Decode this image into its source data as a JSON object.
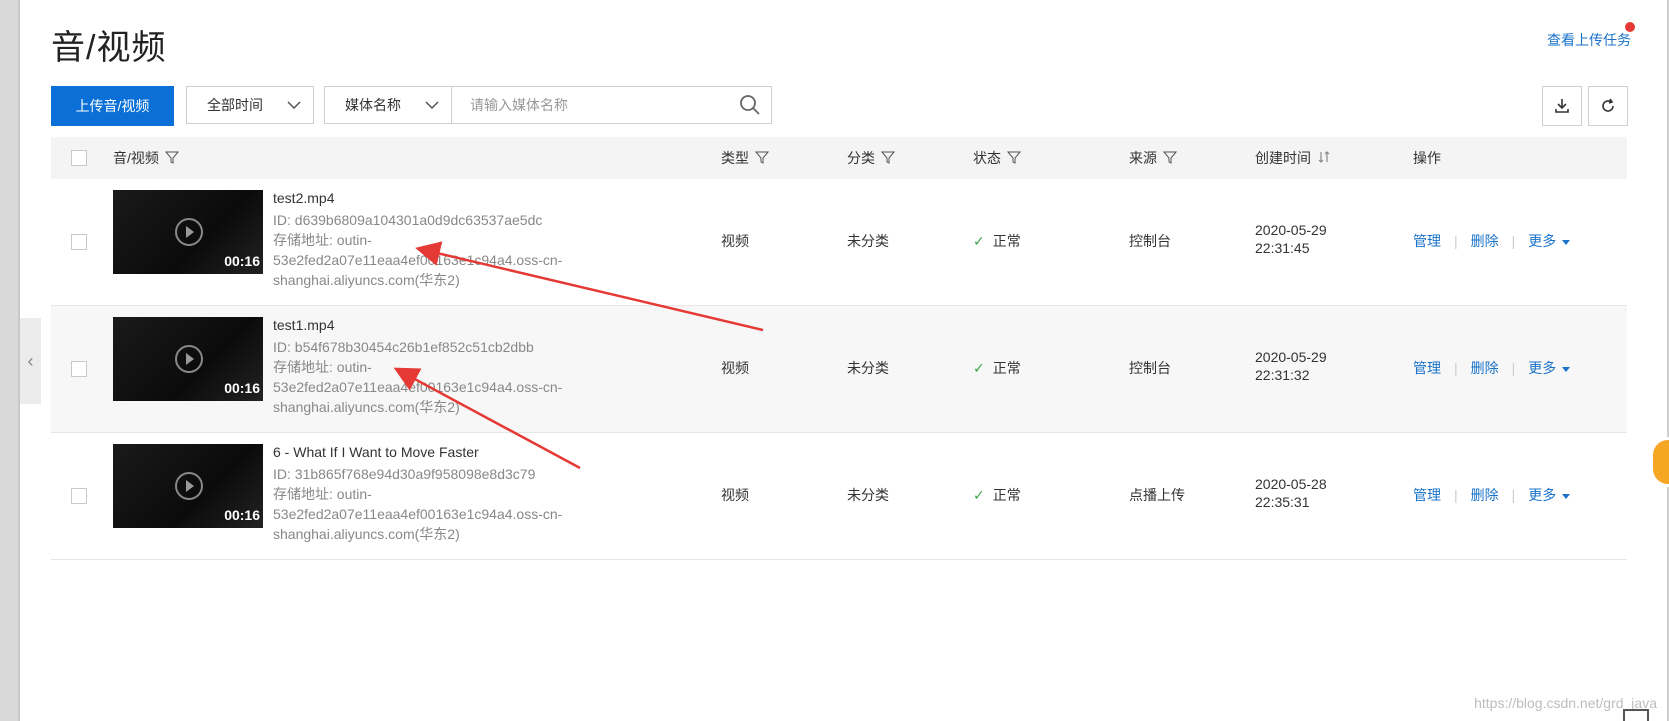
{
  "header": {
    "title": "音/视频",
    "upload_tasks_link": "查看上传任务"
  },
  "toolbar": {
    "upload_button": "上传音/视频",
    "time_filter": "全部时间",
    "search_field_select": "媒体名称",
    "search_placeholder": "请输入媒体名称"
  },
  "table": {
    "columns": {
      "media": "音/视频",
      "type": "类型",
      "category": "分类",
      "status": "状态",
      "source": "来源",
      "created": "创建时间",
      "actions": "操作"
    },
    "rows": [
      {
        "name": "test2.mp4",
        "id": "ID:  d639b6809a104301a0d9dc63537ae5dc",
        "storage_line1": "存储地址:  outin-",
        "storage_line2": "53e2fed2a07e11eaa4ef00163e1c94a4.oss-cn-",
        "storage_line3": "shanghai.aliyuncs.com(华东2)",
        "duration": "00:16",
        "type": "视频",
        "category": "未分类",
        "status": "正常",
        "source": "控制台",
        "created_date": "2020-05-29",
        "created_time": "22:31:45",
        "actions": {
          "manage": "管理",
          "delete": "删除",
          "more": "更多"
        }
      },
      {
        "name": "test1.mp4",
        "id": "ID:  b54f678b30454c26b1ef852c51cb2dbb",
        "storage_line1": "存储地址:  outin-",
        "storage_line2": "53e2fed2a07e11eaa4ef00163e1c94a4.oss-cn-",
        "storage_line3": "shanghai.aliyuncs.com(华东2)",
        "duration": "00:16",
        "type": "视频",
        "category": "未分类",
        "status": "正常",
        "source": "控制台",
        "created_date": "2020-05-29",
        "created_time": "22:31:32",
        "actions": {
          "manage": "管理",
          "delete": "删除",
          "more": "更多"
        }
      },
      {
        "name": "6 - What If I Want to Move Faster",
        "id": "ID:  31b865f768e94d30a9f958098e8d3c79",
        "storage_line1": "存储地址:  outin-",
        "storage_line2": "53e2fed2a07e11eaa4ef00163e1c94a4.oss-cn-",
        "storage_line3": "shanghai.aliyuncs.com(华东2)",
        "duration": "00:16",
        "type": "视频",
        "category": "未分类",
        "status": "正常",
        "source": "点播上传",
        "created_date": "2020-05-28",
        "created_time": "22:35:31",
        "actions": {
          "manage": "管理",
          "delete": "删除",
          "more": "更多"
        }
      }
    ]
  },
  "watermark": "https://blog.csdn.net/grd_java",
  "colors": {
    "primary": "#0a6fd6",
    "link": "#1a73c8",
    "success": "#3aa64a",
    "annotation_arrow": "#e53935"
  }
}
